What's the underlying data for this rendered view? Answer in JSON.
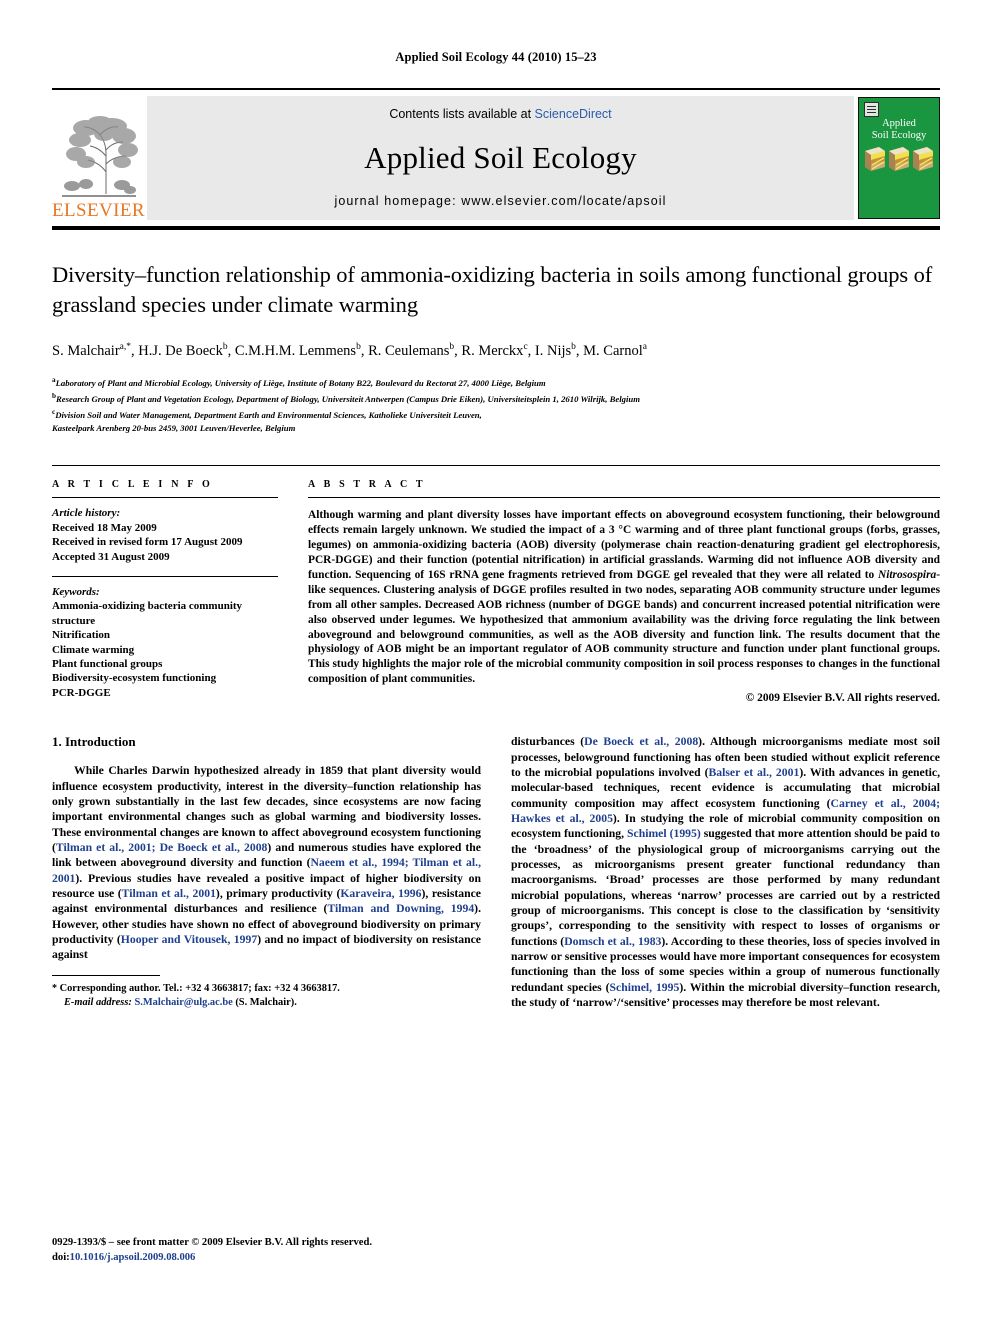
{
  "running_head": "Applied Soil Ecology 44 (2010) 15–23",
  "masthead": {
    "contents_prefix": "Contents lists available at ",
    "sciencedirect": "ScienceDirect",
    "journal_name": "Applied Soil Ecology",
    "homepage": "journal homepage: www.elsevier.com/locate/apsoil",
    "publisher_wordmark": "ELSEVIER",
    "cover_title_line1": "Applied",
    "cover_title_line2": "Soil Ecology",
    "brand_orange": "#E87722",
    "cover_green": "#1a9641",
    "link_blue": "#2a5caa",
    "citation_blue": "#1f3f8f"
  },
  "article": {
    "title": "Diversity–function relationship of ammonia-oxidizing bacteria in soils among functional groups of grassland species under climate warming",
    "authors_html": "S. Malchair<sup>a,</sup><sup>*</sup>, H.J. De Boeck<sup>b</sup>, C.M.H.M. Lemmens<sup>b</sup>, R. Ceulemans<sup>b</sup>, R. Merckx<sup>c</sup>, I. Nijs<sup>b</sup>, M. Carnol<sup>a</sup>",
    "affiliations": [
      "Laboratory of Plant and Microbial Ecology, University of Liège, Institute of Botany B22, Boulevard du Rectorat 27, 4000 Liège, Belgium",
      "Research Group of Plant and Vegetation Ecology, Department of Biology, Universiteit Antwerpen (Campus Drie Eiken), Universiteitsplein 1, 2610 Wilrijk, Belgium",
      "Division Soil and Water Management, Department Earth and Environmental Sciences, Katholieke Universiteit Leuven,",
      "Kasteelpark Arenberg 20-bus 2459, 3001 Leuven/Heverlee, Belgium"
    ],
    "affiliation_marks": [
      "a",
      "b",
      "c",
      ""
    ]
  },
  "article_info": {
    "label": "A R T I C L E  I N F O",
    "history_label": "Article history:",
    "history": [
      "Received 18 May 2009",
      "Received in revised form 17 August 2009",
      "Accepted 31 August 2009"
    ],
    "keywords_label": "Keywords:",
    "keywords": [
      "Ammonia-oxidizing bacteria community structure",
      "Nitrification",
      "Climate warming",
      "Plant functional groups",
      "Biodiversity-ecosystem functioning",
      "PCR-DGGE"
    ]
  },
  "abstract": {
    "label": "A B S T R A C T",
    "part1": "Although warming and plant diversity losses have important effects on aboveground ecosystem functioning, their belowground effects remain largely unknown. We studied the impact of a 3 °C warming and of three plant functional groups (forbs, grasses, legumes) on ammonia-oxidizing bacteria (AOB) diversity (polymerase chain reaction-denaturing gradient gel electrophoresis, PCR-DGGE) and their function (potential nitrification) in artificial grasslands. Warming did not influence AOB diversity and function. Sequencing of 16S rRNA gene fragments retrieved from DGGE gel revealed that they were all related to ",
    "italic_term": "Nitrosospira",
    "part2": "-like sequences. Clustering analysis of DGGE profiles resulted in two nodes, separating AOB community structure under legumes from all other samples. Decreased AOB richness (number of DGGE bands) and concurrent increased potential nitrification were also observed under legumes. We hypothesized that ammonium availability was the driving force regulating the link between aboveground and belowground communities, as well as the AOB diversity and function link. The results document that the physiology of AOB might be an important regulator of AOB community structure and function under plant functional groups. This study highlights the major role of the microbial community composition in soil process responses to changes in the functional composition of plant communities.",
    "copyright": "© 2009 Elsevier B.V. All rights reserved."
  },
  "body": {
    "section_number_title": "1. Introduction",
    "left_paragraph_html": "While Charles Darwin hypothesized already in 1859 that plant diversity would influence ecosystem productivity, interest in the diversity–function relationship has only grown substantially in the last few decades, since ecosystems are now facing important environmental changes such as global warming and biodiversity losses. These environmental changes are known to affect aboveground ecosystem functioning (<span class=\"cite\">Tilman et al., 2001; De Boeck et al., 2008</span>) and numerous studies have explored the link between aboveground diversity and function (<span class=\"cite\">Naeem et al., 1994; Tilman et al., 2001</span>). Previous studies have revealed a positive impact of higher biodiversity on resource use (<span class=\"cite\">Tilman et al., 2001</span>), primary productivity (<span class=\"cite\">Karaveira, 1996</span>), resistance against environmental disturbances and resilience (<span class=\"cite\">Tilman and Downing, 1994</span>). However, other studies have shown no effect of aboveground biodiversity on primary productivity (<span class=\"cite\">Hooper and Vitousek, 1997</span>) and no impact of biodiversity on resistance against",
    "right_paragraph_html": "disturbances (<span class=\"cite\">De Boeck et al., 2008</span>). Although microorganisms mediate most soil processes, belowground functioning has often been studied without explicit reference to the microbial populations involved (<span class=\"cite\">Balser et al., 2001</span>). With advances in genetic, molecular-based techniques, recent evidence is accumulating that microbial community composition may affect ecosystem functioning (<span class=\"cite\">Carney et al., 2004; Hawkes et al., 2005</span>). In studying the role of microbial community composition on ecosystem functioning, <span class=\"cite\">Schimel (1995)</span> suggested that more attention should be paid to the ‘broadness’ of the physiological group of microorganisms carrying out the processes, as microorganisms present greater functional redundancy than macroorganisms. ‘Broad’ processes are those performed by many redundant microbial populations, whereas ‘narrow’ processes are carried out by a restricted group of microorganisms. This concept is close to the classification by ‘sensitivity groups’, corresponding to the sensitivity with respect to losses of organisms or functions (<span class=\"cite\">Domsch et al., 1983</span>). According to these theories, loss of species involved in narrow or sensitive processes would have more important consequences for ecosystem functioning than the loss of some species within a group of numerous functionally redundant species (<span class=\"cite\">Schimel, 1995</span>). Within the microbial diversity–function research, the study of ‘narrow’/‘sensitive’ processes may therefore be most relevant."
  },
  "footnote": {
    "star": "*",
    "corresponding": "Corresponding author. Tel.: +32 4 3663817; fax: +32 4 3663817.",
    "email_label": "E-mail address:",
    "email": "S.Malchair@ulg.ac.be",
    "email_owner": "(S. Malchair)."
  },
  "page_footer": {
    "issn_line": "0929-1393/$ – see front matter © 2009 Elsevier B.V. All rights reserved.",
    "doi_label": "doi:",
    "doi": "10.1016/j.apsoil.2009.08.006"
  }
}
